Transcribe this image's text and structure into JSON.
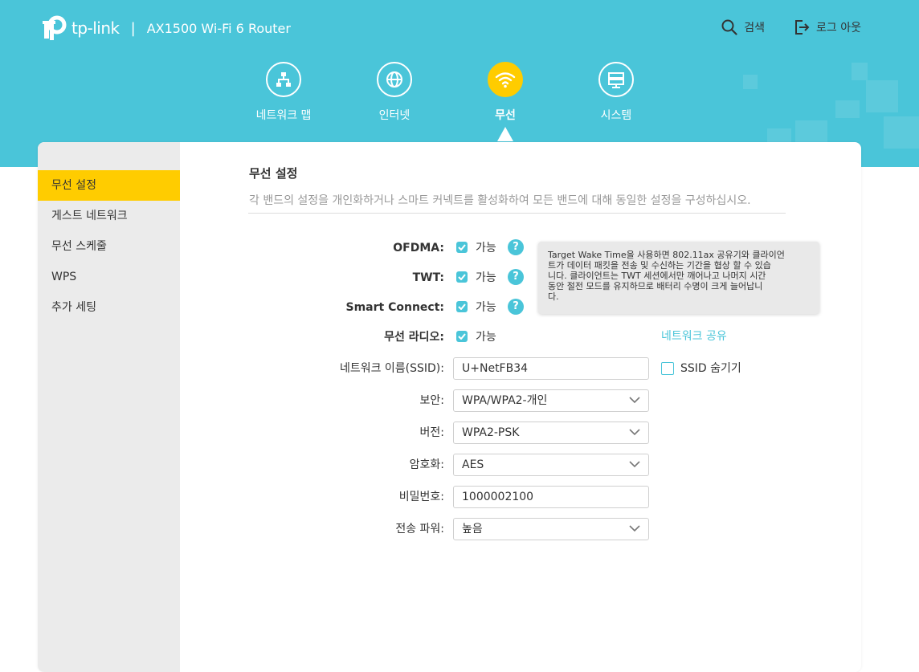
{
  "brand": {
    "logo_text": "tp-link",
    "separator": "|",
    "model": "AX1500 Wi-Fi 6 Router"
  },
  "header": {
    "search_label": "검색",
    "logout_label": "로그 아웃",
    "accent_color": "#4ac5d9",
    "active_color": "#ffcc00"
  },
  "nav": {
    "items": [
      {
        "label": "네트워크 맵",
        "icon": "network-map-icon"
      },
      {
        "label": "인터넷",
        "icon": "globe-icon"
      },
      {
        "label": "무선",
        "icon": "wifi-icon",
        "active": true
      },
      {
        "label": "시스템",
        "icon": "system-icon"
      }
    ]
  },
  "sidebar": {
    "items": [
      {
        "label": "무선 설정",
        "active": true
      },
      {
        "label": "게스트 네트워크"
      },
      {
        "label": "무선 스케줄"
      },
      {
        "label": "WPS"
      },
      {
        "label": "추가 세팅"
      }
    ]
  },
  "section": {
    "title": "무선 설정",
    "description": "각 밴드의 설정을 개인화하거나 스마트 커넥트를 활성화하여 모든 밴드에 대해 동일한 설정을 구성하십시오."
  },
  "form": {
    "ofdma": {
      "label": "OFDMA:",
      "checkbox_label": "가능",
      "checked": true
    },
    "twt": {
      "label": "TWT:",
      "checkbox_label": "가능",
      "checked": true
    },
    "smart_connect": {
      "label": "Smart Connect:",
      "checkbox_label": "가능",
      "checked": true
    },
    "radio": {
      "label": "무선 라디오:",
      "checkbox_label": "가능",
      "checked": true
    },
    "ssid": {
      "label": "네트워크 이름(SSID):",
      "value": "U+NetFB34"
    },
    "security": {
      "label": "보안:",
      "value": "WPA/WPA2-개인"
    },
    "version": {
      "label": "버전:",
      "value": "WPA2-PSK"
    },
    "encryption": {
      "label": "암호화:",
      "value": "AES"
    },
    "password": {
      "label": "비밀번호:",
      "value": "1000002100"
    },
    "tx_power": {
      "label": "전송 파워:",
      "value": "높음"
    },
    "share_link": "네트워크 공유",
    "hide_ssid_label": "SSID 숨기기",
    "hide_ssid_checked": false,
    "help_glyph": "?"
  },
  "tooltip": {
    "lines": [
      "Target Wake Time을 사용하면 802.11ax 공유기와 클라이언",
      "트가 데이터 패킷을 전송 및 수신하는 기간을 협상 할 수 있습",
      "니다. 클라이언트는 TWT 세션에서만 깨어나고 나머지 시간",
      "동안 절전 모드를 유지하므로 배터리 수명이 크게 늘어납니",
      "다."
    ]
  }
}
